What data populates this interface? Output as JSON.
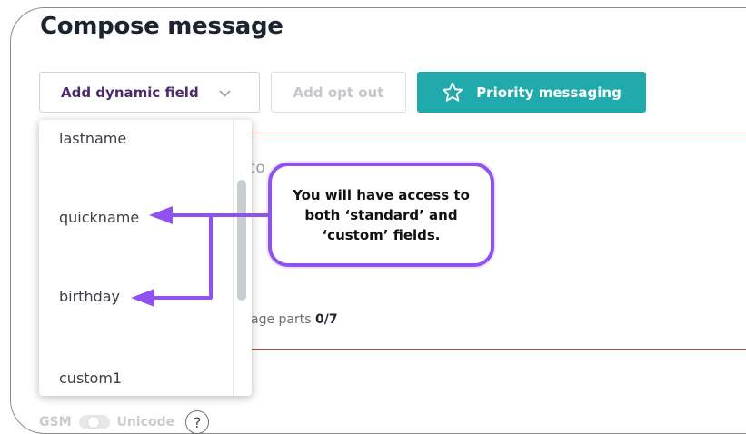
{
  "page": {
    "title": "Compose message"
  },
  "toolbar": {
    "dynamic_field_label": "Add dynamic field",
    "opt_out_label": "Add opt out",
    "priority_label": "Priority messaging"
  },
  "background": {
    "partial_text": "co",
    "message_parts_prefix": "age parts",
    "message_parts_value": "0/7"
  },
  "encoding": {
    "gsm_label": "GSM",
    "unicode_label": "Unicode",
    "help_label": "?"
  },
  "dropdown": {
    "items": [
      "lastname",
      "quickname",
      "birthday",
      "custom1"
    ]
  },
  "callout": {
    "text": "You will have access to both ‘standard’ and ‘custom’ fields."
  },
  "colors": {
    "accent_teal": "#20aaac",
    "callout_purple": "#8f52ee",
    "divider_red": "#c14040",
    "title_dark": "#1d2330"
  }
}
